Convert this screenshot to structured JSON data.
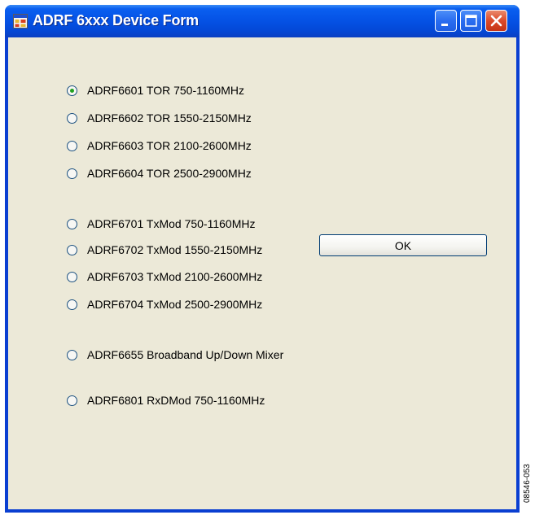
{
  "window": {
    "title": "ADRF 6xxx Device Form",
    "icon": "app-form-icon",
    "controls": [
      "minimize-icon",
      "maximize-icon",
      "close-icon"
    ],
    "colors": {
      "titlebar": "#0553e6",
      "client": "#ece9d8",
      "close": "#db4a2a"
    }
  },
  "options": [
    {
      "label": "ADRF6601 TOR 750-1160MHz",
      "selected": true
    },
    {
      "label": "ADRF6602 TOR 1550-2150MHz",
      "selected": false
    },
    {
      "label": "ADRF6603 TOR 2100-2600MHz",
      "selected": false
    },
    {
      "label": "ADRF6604 TOR 2500-2900MHz",
      "selected": false
    },
    {
      "label": "ADRF6701 TxMod 750-1160MHz",
      "selected": false
    },
    {
      "label": "ADRF6702 TxMod 1550-2150MHz",
      "selected": false
    },
    {
      "label": "ADRF6703 TxMod 2100-2600MHz",
      "selected": false
    },
    {
      "label": "ADRF6704 TxMod 2500-2900MHz",
      "selected": false
    },
    {
      "label": "ADRF6655 Broadband Up/Down Mixer",
      "selected": false
    },
    {
      "label": "ADRF6801 RxDMod 750-1160MHz",
      "selected": false
    }
  ],
  "ok_button": {
    "label": "OK"
  },
  "figure_id": "08546-053"
}
